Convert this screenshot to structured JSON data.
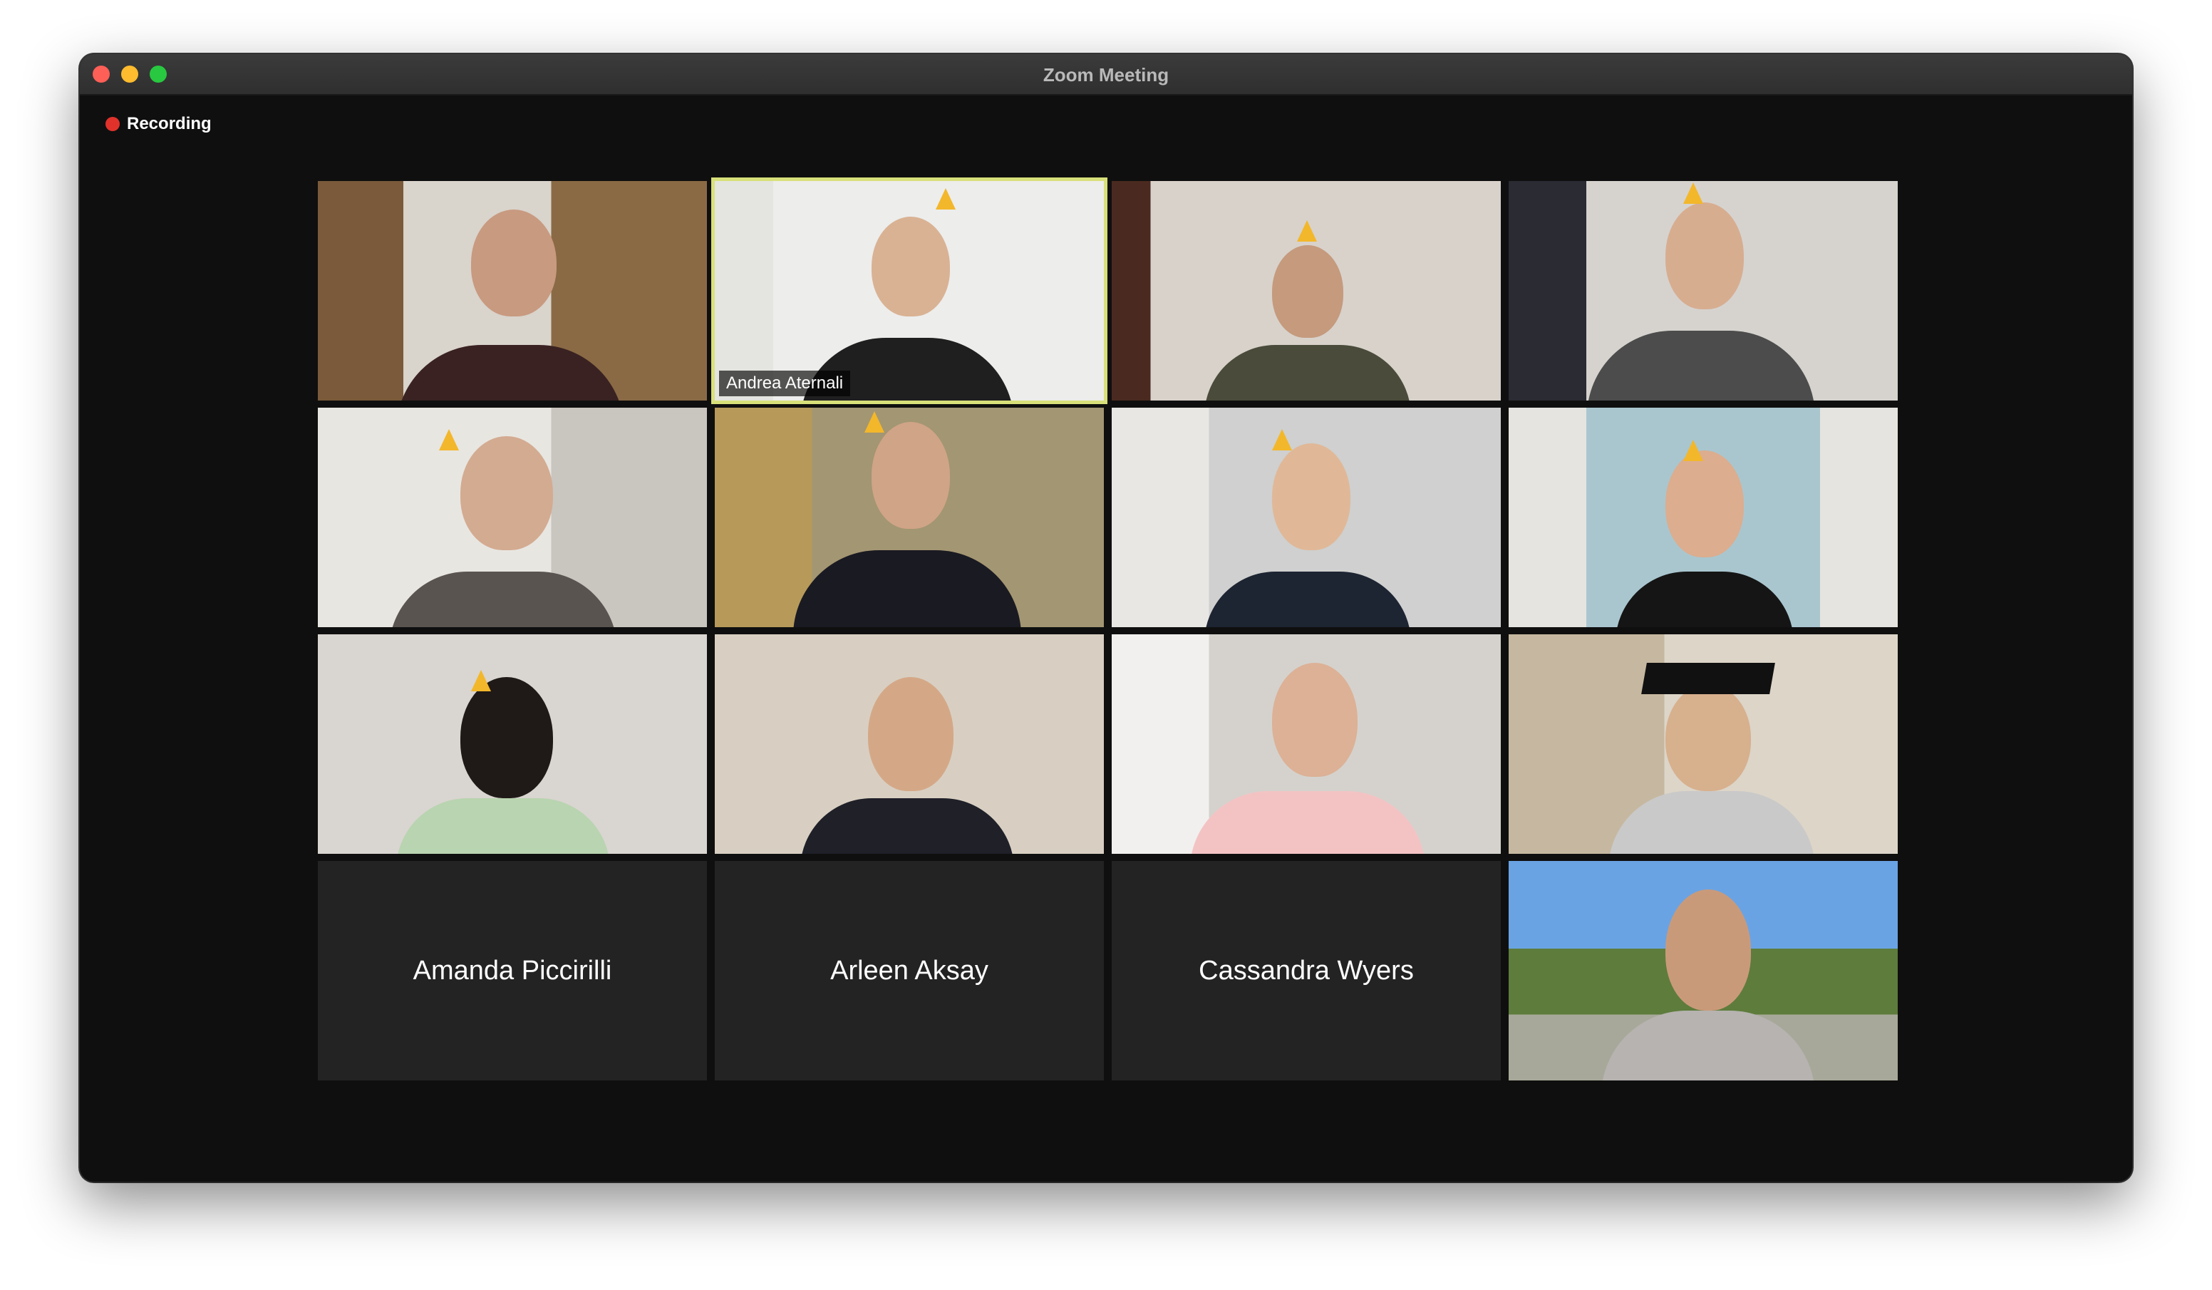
{
  "window": {
    "title": "Zoom Meeting"
  },
  "recording": {
    "label": "Recording"
  },
  "participants": [
    {
      "name": "",
      "video": true
    },
    {
      "name": "Andrea Aternali",
      "video": true,
      "active_speaker": true
    },
    {
      "name": "",
      "video": true
    },
    {
      "name": "",
      "video": true
    },
    {
      "name": "",
      "video": true
    },
    {
      "name": "",
      "video": true
    },
    {
      "name": "",
      "video": true
    },
    {
      "name": "",
      "video": true
    },
    {
      "name": "",
      "video": true
    },
    {
      "name": "",
      "video": true
    },
    {
      "name": "",
      "video": true
    },
    {
      "name": "",
      "video": true
    },
    {
      "name": "Amanda Piccirilli",
      "video": false
    },
    {
      "name": "Arleen Aksay",
      "video": false
    },
    {
      "name": "Cassandra Wyers",
      "video": false
    },
    {
      "name": "",
      "video": true
    }
  ],
  "colors": {
    "active_border": "#d8e07a",
    "recording_dot": "#e0322b",
    "tile_empty": "#232323"
  }
}
